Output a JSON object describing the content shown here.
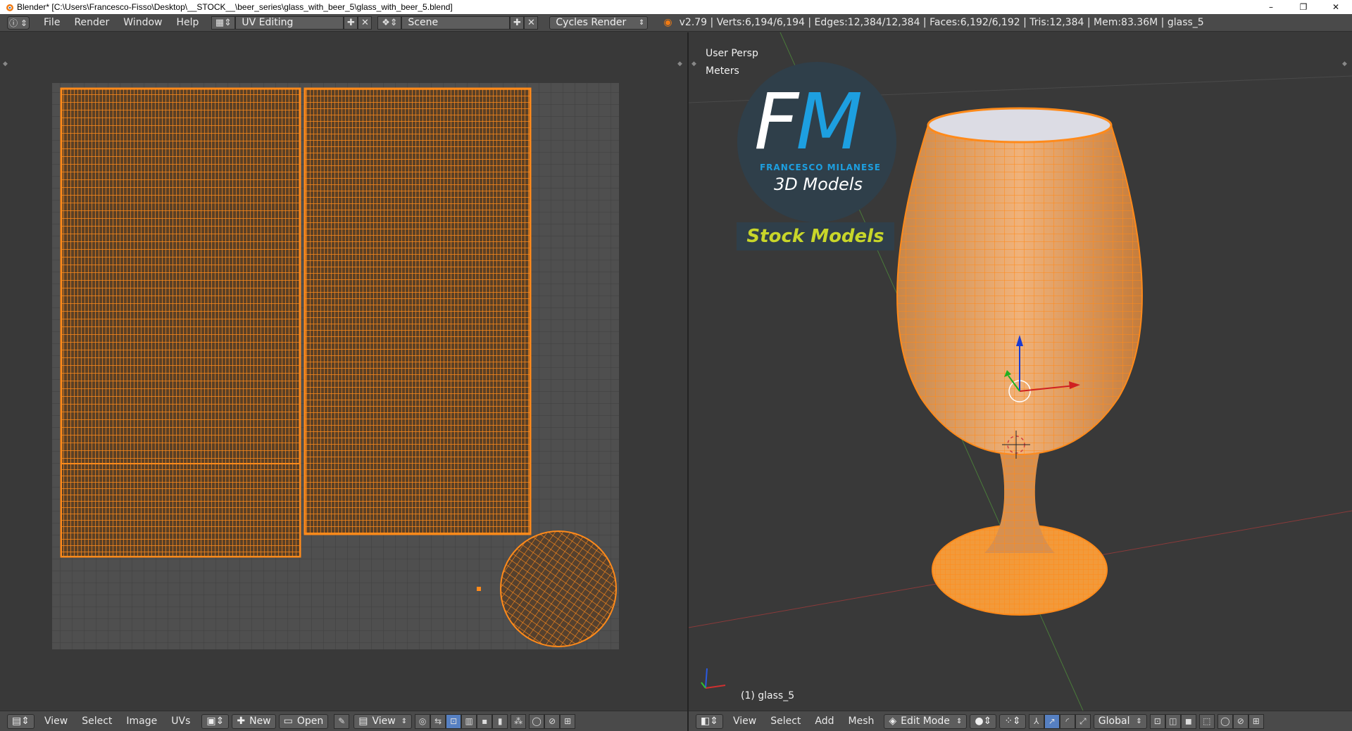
{
  "window": {
    "title": "Blender* [C:\\Users\\Francesco-Fisso\\Desktop\\__STOCK__\\beer_series\\glass_with_beer_5\\glass_with_beer_5.blend]",
    "minimize": "–",
    "maximize": "❐",
    "close": "✕"
  },
  "info_header": {
    "menus": [
      "File",
      "Render",
      "Window",
      "Help"
    ],
    "layout": "UV Editing",
    "scene": "Scene",
    "engine": "Cycles Render",
    "stats": "v2.79 | Verts:6,194/6,194 | Edges:12,384/12,384 | Faces:6,192/6,192 | Tris:12,384 | Mem:83.36M | glass_5"
  },
  "uv_editor": {
    "menus": [
      "View",
      "Select",
      "Image",
      "UVs"
    ],
    "new_label": "New",
    "open_label": "Open",
    "view_label": "View"
  },
  "view3d": {
    "view_name": "User Persp",
    "units": "Meters",
    "object_label": "(1) glass_5",
    "menus": [
      "View",
      "Select",
      "Add",
      "Mesh"
    ],
    "mode": "Edit Mode",
    "orientation": "Global"
  },
  "logo": {
    "letter_f": "F",
    "letter_m": "M",
    "brand": "FRANCESCO MILANESE",
    "subtitle": "3D Models",
    "badge": "Stock Models"
  },
  "colors": {
    "accent_orange": "#ff8a1a",
    "header_bg": "#4a4a4a",
    "editor_bg": "#393939",
    "logo_blue": "#1d9fe0",
    "badge_yellow": "#c8d62a"
  }
}
